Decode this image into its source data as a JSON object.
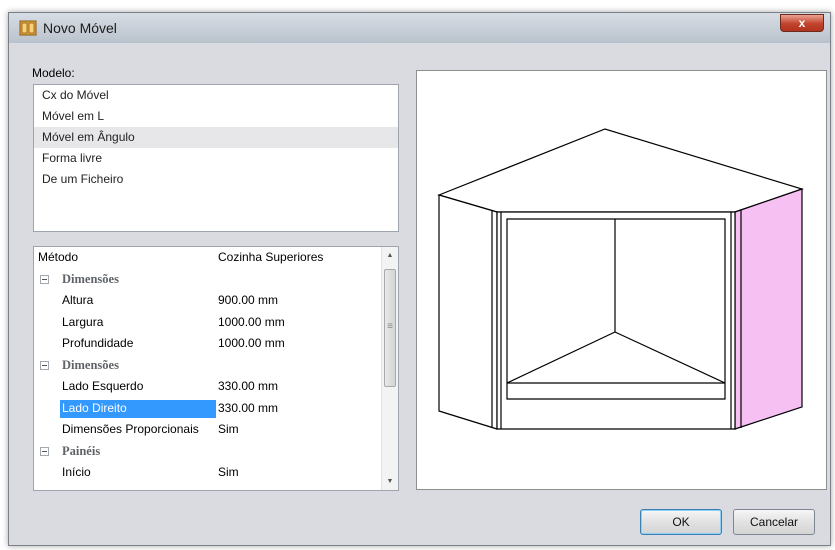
{
  "window": {
    "title": "Novo Móvel",
    "close_label": "x"
  },
  "modelo": {
    "label": "Modelo:",
    "items": [
      {
        "label": "Cx do Móvel",
        "selected": false
      },
      {
        "label": "Móvel em L",
        "selected": false
      },
      {
        "label": "Móvel em Ângulo",
        "selected": true
      },
      {
        "label": "Forma livre",
        "selected": false
      },
      {
        "label": "De um Ficheiro",
        "selected": false
      }
    ]
  },
  "properties": {
    "header": {
      "key": "Método",
      "value": "Cozinha Superiores"
    },
    "rows": [
      {
        "type": "category",
        "key": "Dimensões"
      },
      {
        "type": "prop",
        "key": "Altura",
        "value": "900.00 mm"
      },
      {
        "type": "prop",
        "key": "Largura",
        "value": "1000.00 mm"
      },
      {
        "type": "prop",
        "key": "Profundidade",
        "value": "1000.00 mm"
      },
      {
        "type": "category",
        "key": "Dimensões"
      },
      {
        "type": "prop",
        "key": "Lado Esquerdo",
        "value": "330.00 mm"
      },
      {
        "type": "prop",
        "key": "Lado Direito",
        "value": "330.00 mm",
        "selected": true
      },
      {
        "type": "prop",
        "key": "Dimensões Proporcionais",
        "value": "Sim"
      },
      {
        "type": "category",
        "key": "Painéis"
      },
      {
        "type": "prop",
        "key": "Início",
        "value": "Sim"
      }
    ]
  },
  "buttons": {
    "ok": "OK",
    "cancel": "Cancelar"
  },
  "colors": {
    "accent_panel": "#f6c0f3",
    "selection": "#3399ff"
  }
}
